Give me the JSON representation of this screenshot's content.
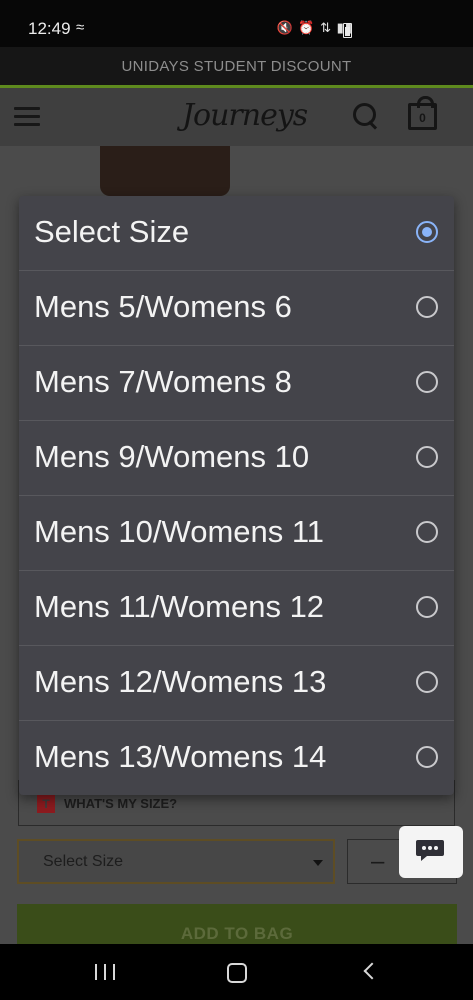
{
  "status_bar": {
    "time": "12:49",
    "wifi_icon": "wifi-calling-icon",
    "icons": [
      "mute-icon",
      "alarm-icon",
      "signal-icon",
      "battery-icon"
    ]
  },
  "promo_banner": {
    "text": "UNIDAYS STUDENT DISCOUNT"
  },
  "header": {
    "logo_text": "Journeys",
    "cart_count": "0"
  },
  "dialog": {
    "options": [
      {
        "label": "Select Size",
        "selected": true
      },
      {
        "label": "Mens 5/Womens 6",
        "selected": false
      },
      {
        "label": "Mens 7/Womens 8",
        "selected": false
      },
      {
        "label": "Mens 9/Womens 10",
        "selected": false
      },
      {
        "label": "Mens 10/Womens 11",
        "selected": false
      },
      {
        "label": "Mens 11/Womens 12",
        "selected": false
      },
      {
        "label": "Mens 12/Womens 13",
        "selected": false
      },
      {
        "label": "Mens 13/Womens 14",
        "selected": false
      }
    ]
  },
  "page": {
    "size_guide_badge": "T",
    "size_guide_label": "WHAT'S MY SIZE?",
    "size_select_label": "Select Size",
    "quantity_minus": "–",
    "add_to_bag_label": "ADD TO BAG"
  },
  "colors": {
    "dialog_bg": "#44444a",
    "radio_selected": "#8ab4f8",
    "banner_accent": "#5e8a1e"
  }
}
